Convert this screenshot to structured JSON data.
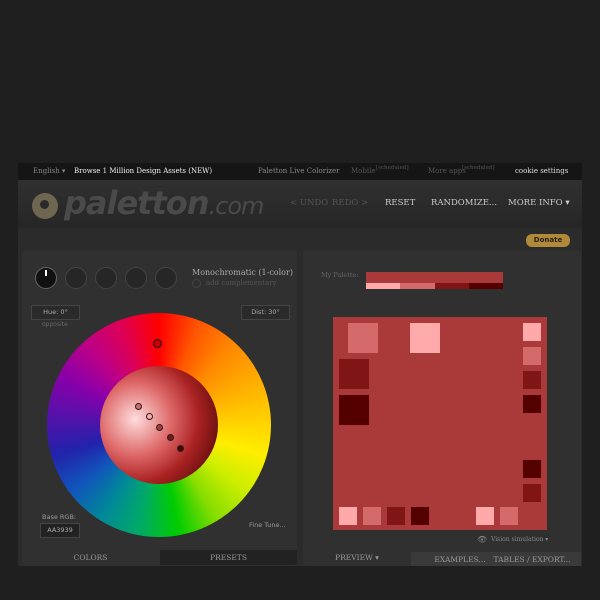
{
  "topbar": {
    "language": "English ▾",
    "browse": "Browse 1 Million Design Assets (NEW)",
    "colorizer": "Paletton Live Colorizer",
    "mobile": "Mobile",
    "mobile_tag": "[scheduled]",
    "more_apps": "More apps",
    "more_apps_tag": "[scheduled]",
    "cookie": "cookie settings"
  },
  "header": {
    "logo": "paletton",
    "logo_suffix": ".com",
    "undo": "< UNDO",
    "redo": "REDO >",
    "reset": "RESET",
    "randomize": "RANDOMIZE...",
    "more_info": "MORE INFO ▾"
  },
  "donate": "Donate",
  "scheme": {
    "title": "Monochromatic (1-color)",
    "add_complementary": "add complementary",
    "hue": "Hue: 0°",
    "opposite": "opposite",
    "dist": "Dist: 30°",
    "base_rgb_label": "Base RGB:",
    "base_rgb": "AA3939",
    "fine_tune": "Fine Tune..."
  },
  "left_tabs": {
    "colors": "COLORS",
    "presets": "PRESETS"
  },
  "preview": {
    "my_palette": "My Palette:",
    "vision": "Vision simulation ▾",
    "tab_preview": "PREVIEW ▾",
    "tab_examples": "EXAMPLES...",
    "tab_tables": "TABLES / EXPORT..."
  },
  "colors": {
    "base": "#AA3939",
    "lightest": "#FFAAAA",
    "light": "#D46A6A",
    "dark": "#801515",
    "darkest": "#550000"
  }
}
